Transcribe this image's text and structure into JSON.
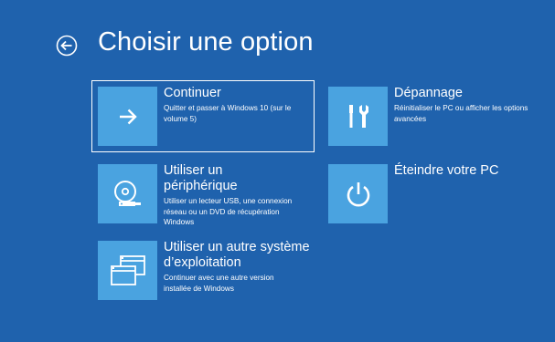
{
  "header": {
    "title": "Choisir une option",
    "back_icon": "back-arrow-circle-icon"
  },
  "colors": {
    "background": "#1f62ad",
    "tile": "#4aa3e0",
    "text": "#ffffff"
  },
  "options": [
    {
      "id": "continue",
      "title": "Continuer",
      "description": "Quitter et passer à Windows 10 (sur le volume 5)",
      "icon": "arrow-right-icon",
      "selected": true
    },
    {
      "id": "use-device",
      "title": "Utiliser un périphérique",
      "description": "Utiliser un lecteur USB, une connexion réseau ou un DVD de récupération Windows",
      "icon": "disc-drive-icon",
      "selected": false
    },
    {
      "id": "other-os",
      "title": "Utiliser un autre système d’exploitation",
      "description": "Continuer avec une autre version installée de Windows",
      "icon": "windows-stack-icon",
      "selected": false
    },
    {
      "id": "troubleshoot",
      "title": "Dépannage",
      "description": "Réinitialiser le PC ou afficher les options avancées",
      "icon": "tools-icon",
      "selected": false
    },
    {
      "id": "shutdown",
      "title": "Éteindre votre PC",
      "description": "",
      "icon": "power-icon",
      "selected": false
    }
  ]
}
